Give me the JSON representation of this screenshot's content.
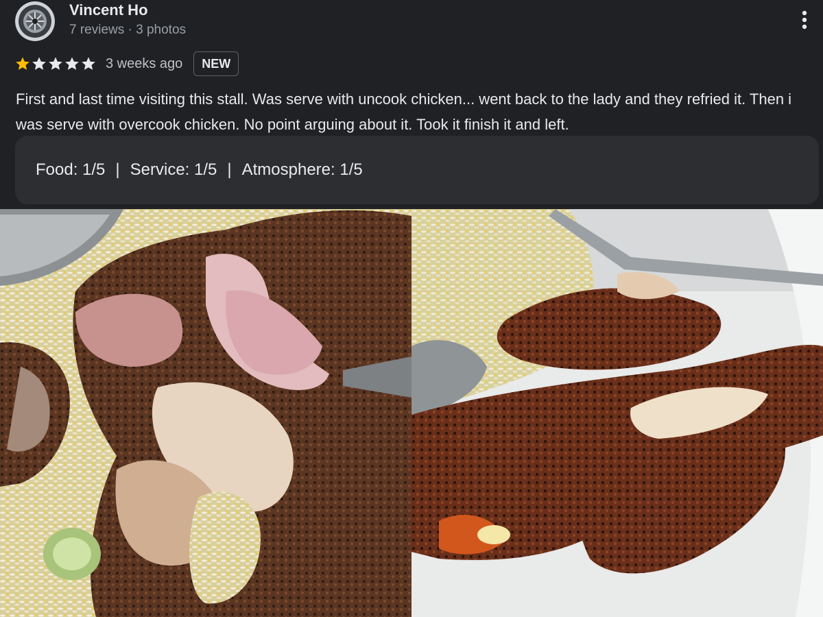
{
  "review": {
    "user": {
      "name": "Vincent Ho",
      "meta": "7 reviews · 3 photos",
      "avatar_icon": "wheel-avatar-icon"
    },
    "more_icon": "more-vert-icon",
    "rating": {
      "stars_filled": 1,
      "stars_total": 5,
      "filled_color": "#fbbc04",
      "empty_color": "#e8eaed"
    },
    "time_ago": "3 weeks ago",
    "badge": "NEW",
    "text": "First and last time visiting this stall. Was serve with uncook chicken... went back to the lady and they refried it. Then i was serve with overcook chicken. No point arguing about it. Took it finish it and left.",
    "sub_ratings": {
      "food": "Food: 1/5",
      "service": "Service: 1/5",
      "atmosphere": "Atmosphere: 1/5",
      "separator": "|"
    }
  },
  "photos": {
    "left_icon": "undercooked-chicken-photo",
    "right_icon": "overcooked-chicken-photo"
  },
  "colors": {
    "background": "#202124",
    "card": "#2d2e31",
    "text": "#e8eaed",
    "muted": "#9aa0a6"
  }
}
